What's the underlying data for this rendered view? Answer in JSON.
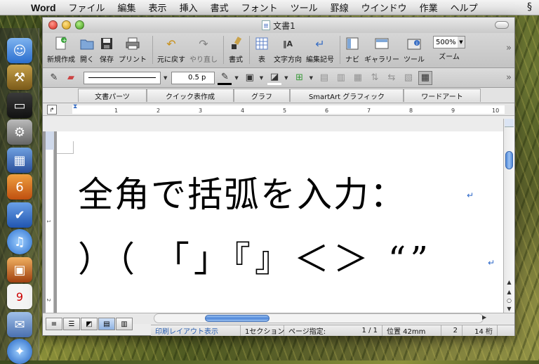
{
  "menubar": {
    "app_name": "Word",
    "items": [
      "ファイル",
      "編集",
      "表示",
      "挿入",
      "書式",
      "フォント",
      "ツール",
      "罫線",
      "ウインドウ",
      "作業",
      "ヘルプ"
    ]
  },
  "window": {
    "title": "文書1"
  },
  "toolbar": {
    "buttons": [
      {
        "label": "新規作成",
        "icon": "new-doc-icon"
      },
      {
        "label": "開く",
        "icon": "open-folder-icon"
      },
      {
        "label": "保存",
        "icon": "save-icon"
      },
      {
        "label": "プリント",
        "icon": "print-icon"
      },
      {
        "label": "元に戻す",
        "icon": "undo-icon"
      },
      {
        "label": "やり直し",
        "icon": "redo-icon"
      },
      {
        "label": "書式",
        "icon": "format-brush-icon"
      },
      {
        "label": "表",
        "icon": "table-icon"
      },
      {
        "label": "文字方向",
        "icon": "text-direction-icon"
      },
      {
        "label": "編集記号",
        "icon": "formatting-marks-icon"
      },
      {
        "label": "ナビ",
        "icon": "navigation-pane-icon"
      },
      {
        "label": "ギャラリー",
        "icon": "gallery-icon"
      },
      {
        "label": "ツール",
        "icon": "toolbox-icon"
      },
      {
        "label": "ズーム",
        "icon": "zoom-icon"
      }
    ],
    "zoom_value": "500%"
  },
  "fmtbar": {
    "line_weight": "0.5 p"
  },
  "gallery_tabs": [
    "文書パーツ",
    "クイック表作成",
    "グラフ",
    "SmartArt グラフィック",
    "ワードアート"
  ],
  "ruler": {
    "numbers": [
      "1",
      "2",
      "3",
      "4",
      "5",
      "6",
      "7",
      "8",
      "9",
      "10"
    ]
  },
  "vruler": {
    "numbers": [
      "1",
      "2"
    ]
  },
  "document": {
    "line1": "全角で括弧を入力：",
    "line2": "）（ 「」『』＜＞ “”"
  },
  "statusbar": {
    "mode": "印刷レイアウト表示",
    "section": "1セクション",
    "page_label": "ページ指定:",
    "page_value": "1 / 1",
    "position": "位置 42mm",
    "line": "2",
    "column": "14 桁"
  },
  "colors": {
    "accent": "#3a6fc4",
    "window_bg": "#ececec"
  }
}
